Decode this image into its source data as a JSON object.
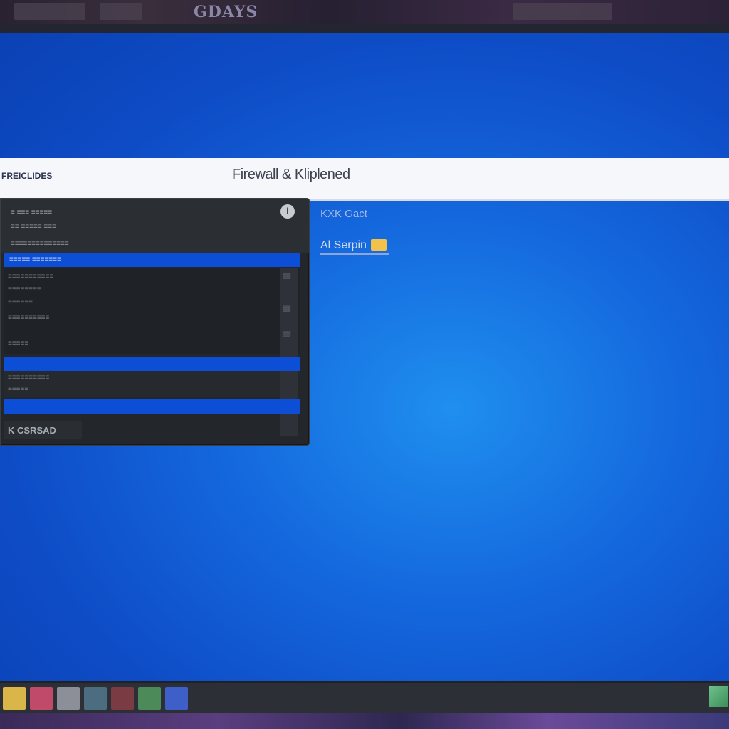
{
  "top_strip": {
    "text": "GDAYS"
  },
  "window": {
    "breadcrumb": "FREICLIDES",
    "title": "Firewall & Kliplened"
  },
  "panel": {
    "header_lines": [
      "≡ ≡≡≡ ≡≡≡≡≡",
      "≡≡ ≡≡≡≡≡ ≡≡≡",
      "≡≡≡≡≡≡≡≡≡≡≡≡≡≡"
    ],
    "info_icon_label": "i",
    "highlight_rows": [
      "≡≡≡≡≡ ≡≡≡≡≡≡≡",
      "",
      ""
    ],
    "list_lines": [
      "≡≡≡≡≡≡≡≡≡≡≡",
      "≡≡≡≡≡≡≡≡",
      "≡≡≡≡≡≡",
      "≡≡≡≡≡≡≡≡≡≡",
      "≡≡≡≡≡"
    ],
    "sub_lines": [
      "≡≡≡≡≡≡≡≡≡≡",
      "≡≡≡≡≡"
    ],
    "bottom_button": "K CSRSAD"
  },
  "right": {
    "label": "KXK Gact",
    "link": "Al Serpin"
  },
  "taskbar": {
    "icon_colors": [
      "#d9b54a",
      "#c04a6a",
      "#8d8f98",
      "#4c6d80",
      "#7a3b42",
      "#4d8a5a",
      "#3e5ec8"
    ]
  }
}
